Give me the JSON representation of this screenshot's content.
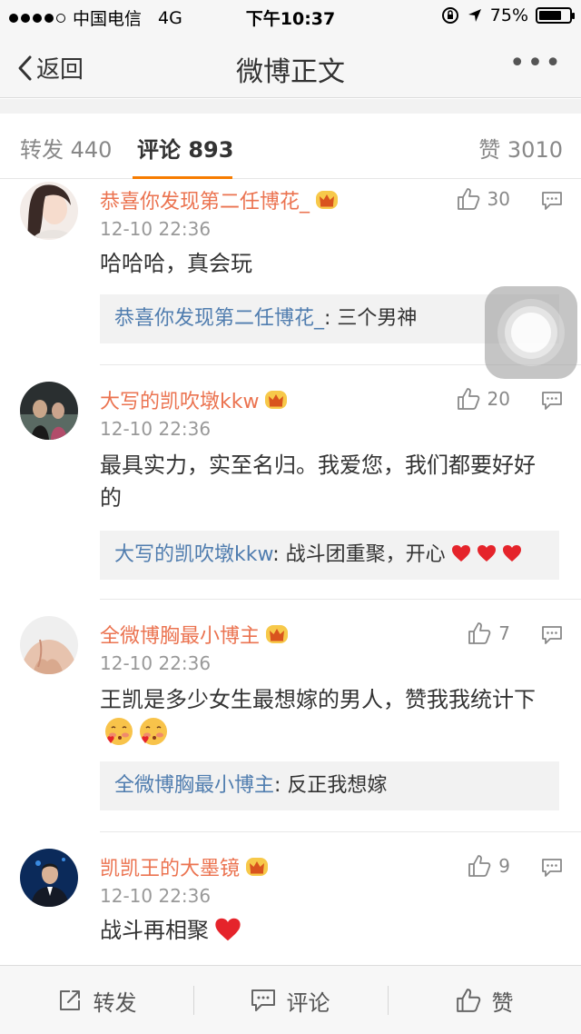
{
  "status_bar": {
    "carrier": "中国电信",
    "network": "4G",
    "time": "下午10:37",
    "battery": "75%",
    "battery_level": 0.75
  },
  "nav": {
    "back_label": "返回",
    "title": "微博正文",
    "more_label": "•••"
  },
  "tabs": {
    "repost_label": "转发 440",
    "comment_label": "评论 893",
    "like_label": "赞 3010"
  },
  "comments": [
    {
      "username": "恭喜你发现第二任博花_",
      "time": "12-10 22:36",
      "likes": "30",
      "content": "哈哈哈，真会玩",
      "reply_user": "恭喜你发现第二任博花_",
      "reply_text": ": 三个男神"
    },
    {
      "username": "大写的凯吹墩kkw",
      "time": "12-10 22:36",
      "likes": "20",
      "content": "最具实力，实至名归。我爱您，我们都要好好的",
      "reply_user": "大写的凯吹墩kkw",
      "reply_text": ": 战斗团重聚，开心"
    },
    {
      "username": "全微博胸最小博主",
      "time": "12-10 22:36",
      "likes": "7",
      "content": "王凯是多少女生最想嫁的男人，赞我我统计下",
      "reply_user": "全微博胸最小博主",
      "reply_text": ": 反正我想嫁"
    },
    {
      "username": "凯凯王的大墨镜",
      "time": "12-10 22:36",
      "likes": "9",
      "content": "战斗再相聚"
    }
  ],
  "bottom_bar": {
    "repost_label": "转发",
    "comment_label": "评论",
    "like_label": "赞"
  },
  "colors": {
    "accent": "#f77c00",
    "username": "#eb7350",
    "reply_user": "#507daf"
  }
}
